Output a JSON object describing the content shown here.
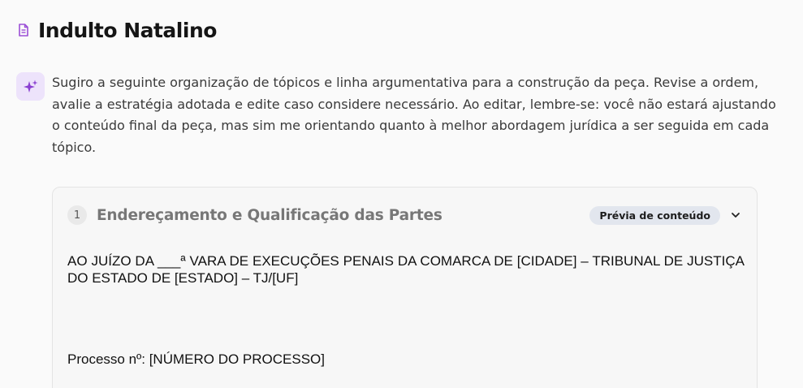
{
  "document": {
    "title": "Indulto Natalino",
    "icon": "document-icon"
  },
  "assistant": {
    "icon": "sparkle-icon",
    "message": "Sugiro a seguinte organização de tópicos e linha argumentativa para a construção da peça. Revise a ordem, avalie a estratégia adotada e edite caso considere necessário. Ao editar, lembre-se: você não estará ajustando o conteúdo final da peça, mas sim me orientando quanto à melhor abordagem jurídica a ser seguida em cada tópico."
  },
  "topic": {
    "number": "1",
    "title": "Endereçamento e Qualificação das Partes",
    "badge": "Prévia de conteúdo",
    "chevron_icon": "chevron-down-icon",
    "content": {
      "address": "AO JUÍZO DA ___ª VARA DE EXECUÇÕES PENAIS DA COMARCA DE [CIDADE] – TRIBUNAL DE JUSTIÇA DO ESTADO DE [ESTADO] – TJ/[UF]",
      "process": "Processo nº: [NÚMERO DO PROCESSO]"
    }
  },
  "colors": {
    "accent": "#9b4fd6",
    "sparkle_bg": "#ede3fb",
    "badge_bg": "#e2e6ee"
  }
}
